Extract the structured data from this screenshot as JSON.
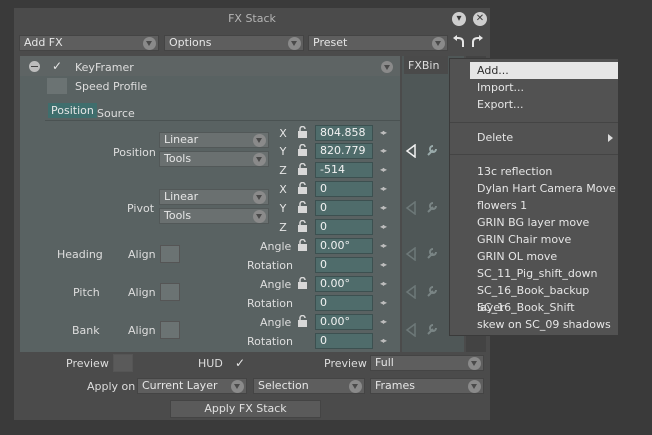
{
  "window": {
    "title": "FX Stack"
  },
  "toolbar": {
    "add_fx": "Add FX",
    "options": "Options",
    "preset": "Preset"
  },
  "fx": {
    "name": "KeyFramer",
    "speed_profile": "Speed Profile",
    "tabs": [
      "Position",
      "Source"
    ],
    "position": {
      "label": "Position",
      "interp": "Linear",
      "tools": "Tools",
      "x": "804.858",
      "y": "820.779",
      "z": "-514"
    },
    "pivot": {
      "label": "Pivot",
      "interp": "Linear",
      "tools": "Tools",
      "x": "0",
      "y": "0",
      "z": "0"
    },
    "axes": {
      "x": "X",
      "y": "Y",
      "z": "Z"
    },
    "heading": {
      "label": "Heading",
      "align": "Align",
      "angle_label": "Angle",
      "angle": "0.00°",
      "rotation_label": "Rotation",
      "rotation": "0"
    },
    "pitch": {
      "label": "Pitch",
      "align": "Align",
      "angle_label": "Angle",
      "angle": "0.00°",
      "rotation_label": "Rotation",
      "rotation": "0"
    },
    "bank": {
      "label": "Bank",
      "align": "Align",
      "angle_label": "Angle",
      "angle": "0.00°",
      "rotation_label": "Rotation",
      "rotation": "0"
    }
  },
  "bottom": {
    "preview_left": "Preview",
    "hud": "HUD",
    "preview_right": "Preview",
    "preview_value": "Full",
    "apply_on": "Apply on",
    "apply_target": "Current Layer",
    "selection": "Selection",
    "frames": "Frames",
    "apply_button": "Apply FX Stack"
  },
  "fxbin": {
    "label": "FXBin"
  },
  "menu": {
    "add": "Add...",
    "import": "Import...",
    "export": "Export...",
    "delete": "Delete",
    "presets": [
      "13c reflection",
      "Dylan Hart Camera Move",
      "flowers 1",
      "GRIN BG layer move",
      "GRIN Chair move",
      "GRIN OL move",
      "SC_11_Pig_shift_down",
      "SC_16_Book_backup layer",
      "SC_16_Book_Shift",
      "skew on SC_09 shadows"
    ]
  },
  "colors": {
    "panel_bg": "#4b4b4b",
    "accent_teal": "#4f6c6b",
    "menu_highlight": "#e6e6e6"
  }
}
